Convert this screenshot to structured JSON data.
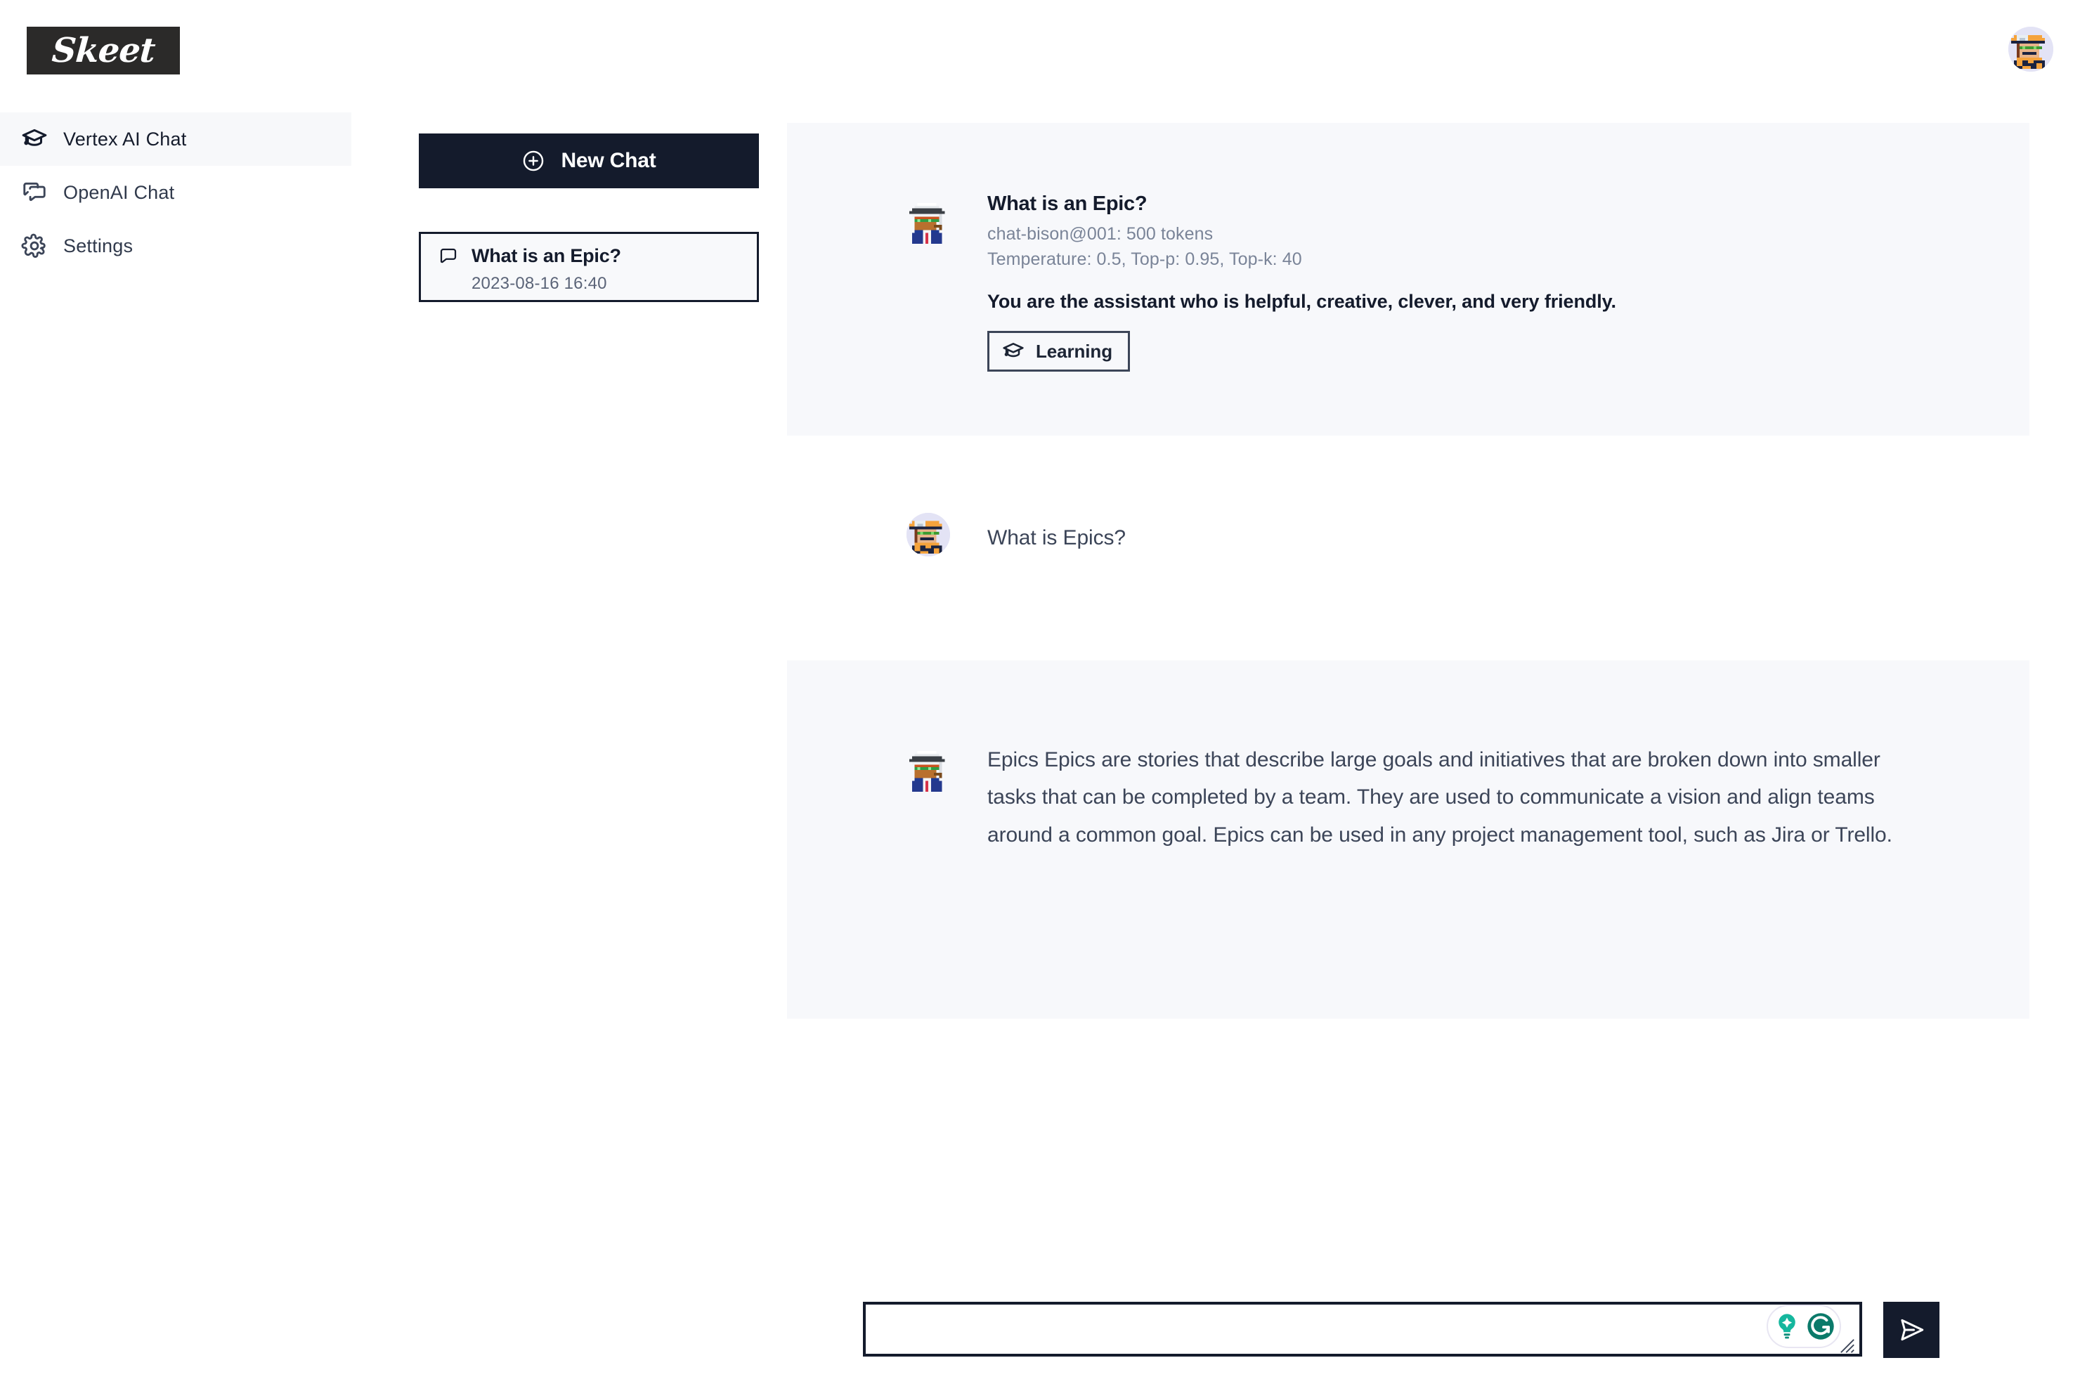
{
  "app": {
    "brand": "Skeet",
    "accent_dark": "#141b2c",
    "tint_bg": "#f7f8fb",
    "muted_text": "#7a8498"
  },
  "sidebar": {
    "items": [
      {
        "label": "Vertex AI Chat",
        "icon": "graduation-cap-icon",
        "active": true
      },
      {
        "label": "OpenAI Chat",
        "icon": "chat-bubbles-icon",
        "active": false
      },
      {
        "label": "Settings",
        "icon": "gear-icon",
        "active": false
      }
    ]
  },
  "chat_list": {
    "new_chat_label": "New Chat",
    "new_chat_icon": "plus-circle-icon",
    "threads": [
      {
        "title": "What is an Epic?",
        "timestamp": "2023-08-16 16:40",
        "icon": "speech-bubble-icon",
        "selected": true
      }
    ]
  },
  "header": {
    "avatar": "user-avatar"
  },
  "conversation": {
    "messages": [
      {
        "role": "system",
        "avatar": "detective-avatar",
        "title": "What is an Epic?",
        "model_line": "chat-bison@001: 500 tokens",
        "params_line": "Temperature: 0.5, Top-p: 0.95, Top-k: 40",
        "system_prompt": "You are the assistant who is helpful, creative, clever, and very friendly.",
        "badge": {
          "label": "Learning",
          "icon": "graduation-cap-icon"
        }
      },
      {
        "role": "user",
        "avatar": "user-avatar",
        "text": "What is Epics?"
      },
      {
        "role": "assistant",
        "avatar": "detective-avatar",
        "text": "Epics Epics are stories that describe large goals and initiatives that are broken down into smaller tasks that can be completed by a team. They are used to communicate a vision and align teams around a common goal. Epics can be used in any project management tool, such as Jira or Trello."
      }
    ]
  },
  "composer": {
    "value": "",
    "placeholder": "",
    "grammarly": {
      "assistant_icon": "grammarly-lightbulb-icon",
      "logo_icon": "grammarly-g-icon",
      "accent": "#11a683"
    },
    "send_icon": "send-paper-plane-icon",
    "resize_handle": "textarea-resize-grip"
  }
}
